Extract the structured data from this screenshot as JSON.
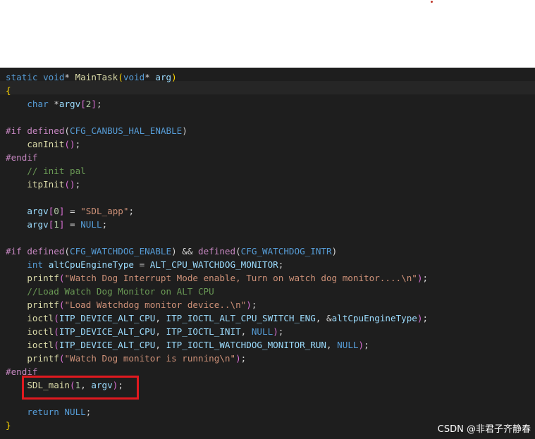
{
  "watermark": "CSDN @非君子齐静春",
  "lines": [
    [
      [
        "k",
        "static "
      ],
      [
        "k",
        "void"
      ],
      [
        "p",
        "* "
      ],
      [
        "f",
        "MainTask"
      ],
      [
        "b",
        "("
      ],
      [
        "k",
        "void"
      ],
      [
        "p",
        "* "
      ],
      [
        "v",
        "arg"
      ],
      [
        "b",
        ")"
      ]
    ],
    [
      [
        "b",
        "{"
      ]
    ],
    [
      [
        "p",
        "    "
      ],
      [
        "k",
        "char "
      ],
      [
        "p",
        "*"
      ],
      [
        "v",
        "argv"
      ],
      [
        "b2",
        "["
      ],
      [
        "n",
        "2"
      ],
      [
        "b2",
        "]"
      ],
      [
        "p",
        ";"
      ]
    ],
    [],
    [
      [
        "m",
        "#if "
      ],
      [
        "m",
        "defined"
      ],
      [
        "p",
        "("
      ],
      [
        "k",
        "CFG_CANBUS_HAL_ENABLE"
      ],
      [
        "p",
        ")"
      ]
    ],
    [
      [
        "p",
        "    "
      ],
      [
        "f",
        "canInit"
      ],
      [
        "b2",
        "()"
      ],
      [
        "p",
        ";"
      ]
    ],
    [
      [
        "m",
        "#endif"
      ]
    ],
    [
      [
        "p",
        "    "
      ],
      [
        "c",
        "// init pal"
      ]
    ],
    [
      [
        "p",
        "    "
      ],
      [
        "f",
        "itpInit"
      ],
      [
        "b2",
        "()"
      ],
      [
        "p",
        ";"
      ]
    ],
    [],
    [
      [
        "p",
        "    "
      ],
      [
        "v",
        "argv"
      ],
      [
        "b2",
        "["
      ],
      [
        "n",
        "0"
      ],
      [
        "b2",
        "]"
      ],
      [
        "p",
        " = "
      ],
      [
        "s",
        "\"SDL_app\""
      ],
      [
        "p",
        ";"
      ]
    ],
    [
      [
        "p",
        "    "
      ],
      [
        "v",
        "argv"
      ],
      [
        "b2",
        "["
      ],
      [
        "n",
        "1"
      ],
      [
        "b2",
        "]"
      ],
      [
        "p",
        " = "
      ],
      [
        "k",
        "NULL"
      ],
      [
        "p",
        ";"
      ]
    ],
    [],
    [
      [
        "m",
        "#if "
      ],
      [
        "m",
        "defined"
      ],
      [
        "p",
        "("
      ],
      [
        "k",
        "CFG_WATCHDOG_ENABLE"
      ],
      [
        "p",
        ") && "
      ],
      [
        "m",
        "defined"
      ],
      [
        "p",
        "("
      ],
      [
        "k",
        "CFG_WATCHDOG_INTR"
      ],
      [
        "p",
        ")"
      ]
    ],
    [
      [
        "p",
        "    "
      ],
      [
        "k",
        "int "
      ],
      [
        "v",
        "altCpuEngineType"
      ],
      [
        "p",
        " = "
      ],
      [
        "v",
        "ALT_CPU_WATCHDOG_MONITOR"
      ],
      [
        "p",
        ";"
      ]
    ],
    [
      [
        "p",
        "    "
      ],
      [
        "f",
        "printf"
      ],
      [
        "b2",
        "("
      ],
      [
        "s",
        "\"Watch Dog Interrupt Mode enable, Turn on watch dog monitor....\\n\""
      ],
      [
        "b2",
        ")"
      ],
      [
        "p",
        ";"
      ]
    ],
    [
      [
        "p",
        "    "
      ],
      [
        "c",
        "//Load Watch Dog Monitor on ALT CPU"
      ]
    ],
    [
      [
        "p",
        "    "
      ],
      [
        "f",
        "printf"
      ],
      [
        "b2",
        "("
      ],
      [
        "s",
        "\"Load Watchdog monitor device..\\n\""
      ],
      [
        "b2",
        ")"
      ],
      [
        "p",
        ";"
      ]
    ],
    [
      [
        "p",
        "    "
      ],
      [
        "f",
        "ioctl"
      ],
      [
        "b2",
        "("
      ],
      [
        "v",
        "ITP_DEVICE_ALT_CPU"
      ],
      [
        "p",
        ", "
      ],
      [
        "v",
        "ITP_IOCTL_ALT_CPU_SWITCH_ENG"
      ],
      [
        "p",
        ", &"
      ],
      [
        "v",
        "altCpuEngineType"
      ],
      [
        "b2",
        ")"
      ],
      [
        "p",
        ";"
      ]
    ],
    [
      [
        "p",
        "    "
      ],
      [
        "f",
        "ioctl"
      ],
      [
        "b2",
        "("
      ],
      [
        "v",
        "ITP_DEVICE_ALT_CPU"
      ],
      [
        "p",
        ", "
      ],
      [
        "v",
        "ITP_IOCTL_INIT"
      ],
      [
        "p",
        ", "
      ],
      [
        "k",
        "NULL"
      ],
      [
        "b2",
        ")"
      ],
      [
        "p",
        ";"
      ]
    ],
    [
      [
        "p",
        "    "
      ],
      [
        "f",
        "ioctl"
      ],
      [
        "b2",
        "("
      ],
      [
        "v",
        "ITP_DEVICE_ALT_CPU"
      ],
      [
        "p",
        ", "
      ],
      [
        "v",
        "ITP_IOCTL_WATCHDOG_MONITOR_RUN"
      ],
      [
        "p",
        ", "
      ],
      [
        "k",
        "NULL"
      ],
      [
        "b2",
        ")"
      ],
      [
        "p",
        ";"
      ]
    ],
    [
      [
        "p",
        "    "
      ],
      [
        "f",
        "printf"
      ],
      [
        "b2",
        "("
      ],
      [
        "s",
        "\"Watch Dog monitor is running\\n\""
      ],
      [
        "b2",
        ")"
      ],
      [
        "p",
        ";"
      ]
    ],
    [
      [
        "m",
        "#endif"
      ]
    ],
    [
      [
        "p",
        "    "
      ],
      [
        "f",
        "SDL_main"
      ],
      [
        "b2",
        "("
      ],
      [
        "n",
        "1"
      ],
      [
        "p",
        ", "
      ],
      [
        "v",
        "argv"
      ],
      [
        "b2",
        ")"
      ],
      [
        "p",
        ";"
      ]
    ],
    [],
    [
      [
        "p",
        "    "
      ],
      [
        "k",
        "return "
      ],
      [
        "k",
        "NULL"
      ],
      [
        "p",
        ";"
      ]
    ],
    [
      [
        "b",
        "}"
      ]
    ]
  ]
}
